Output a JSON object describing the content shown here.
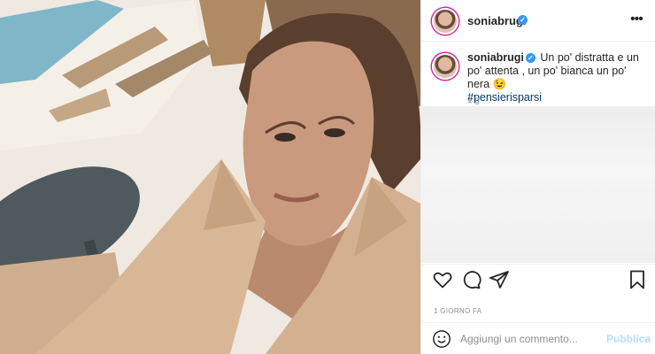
{
  "post": {
    "username": "soniabrugi",
    "verified_icon": "verified-badge-icon",
    "more_icon": "more-options-icon",
    "more_label": "•••",
    "caption_text": "Un po' distratta e un po' attenta , un po' bianca un po' nera 😉",
    "hashtag": "#pensierisparsi",
    "time_ago": "1 g",
    "date": "1 GIORNO FA"
  },
  "actions": {
    "like_icon": "heart-icon",
    "comment_icon": "comment-icon",
    "share_icon": "paper-plane-icon",
    "save_icon": "bookmark-icon"
  },
  "comment_bar": {
    "emoji_icon": "smiley-icon",
    "placeholder": "Aggiungi un commento...",
    "publish_label": "Pubblica"
  },
  "colors": {
    "accent_link": "#00376b",
    "verified": "#3897f0",
    "publish_disabled": "#b2dffc",
    "muted": "#8e8e8e"
  }
}
